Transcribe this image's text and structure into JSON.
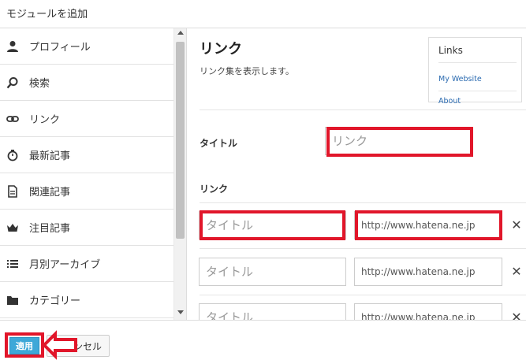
{
  "dialog": {
    "title": "モジュールを追加"
  },
  "sidebar": {
    "items": [
      {
        "label": "プロフィール",
        "icon": "user-icon"
      },
      {
        "label": "検索",
        "icon": "search-icon"
      },
      {
        "label": "リンク",
        "icon": "link-icon"
      },
      {
        "label": "最新記事",
        "icon": "stopwatch-icon"
      },
      {
        "label": "関連記事",
        "icon": "document-icon"
      },
      {
        "label": "注目記事",
        "icon": "crown-icon"
      },
      {
        "label": "月別アーカイブ",
        "icon": "list-icon"
      },
      {
        "label": "カテゴリー",
        "icon": "folder-icon"
      }
    ]
  },
  "module": {
    "heading": "リンク",
    "description": "リンク集を表示します。",
    "preview": {
      "title": "Links",
      "links": [
        "My Website",
        "About"
      ]
    },
    "title_field": {
      "label": "タイトル",
      "value": "リンク"
    },
    "links_label": "リンク",
    "link_rows": [
      {
        "title_placeholder": "タイトル",
        "url_placeholder": "http://www.hatena.ne.jp",
        "remove": "✕"
      },
      {
        "title_placeholder": "タイトル",
        "url_placeholder": "http://www.hatena.ne.jp",
        "remove": "✕"
      },
      {
        "title_placeholder": "タイトル",
        "url_placeholder": "http://www.hatena.ne.jp",
        "remove": "✕"
      }
    ]
  },
  "footer": {
    "apply_label": "適用",
    "cancel_label": "キャンセル"
  },
  "colors": {
    "highlight": "#e1162a",
    "accent": "#3ea8d8",
    "link": "#2a6ab0"
  }
}
